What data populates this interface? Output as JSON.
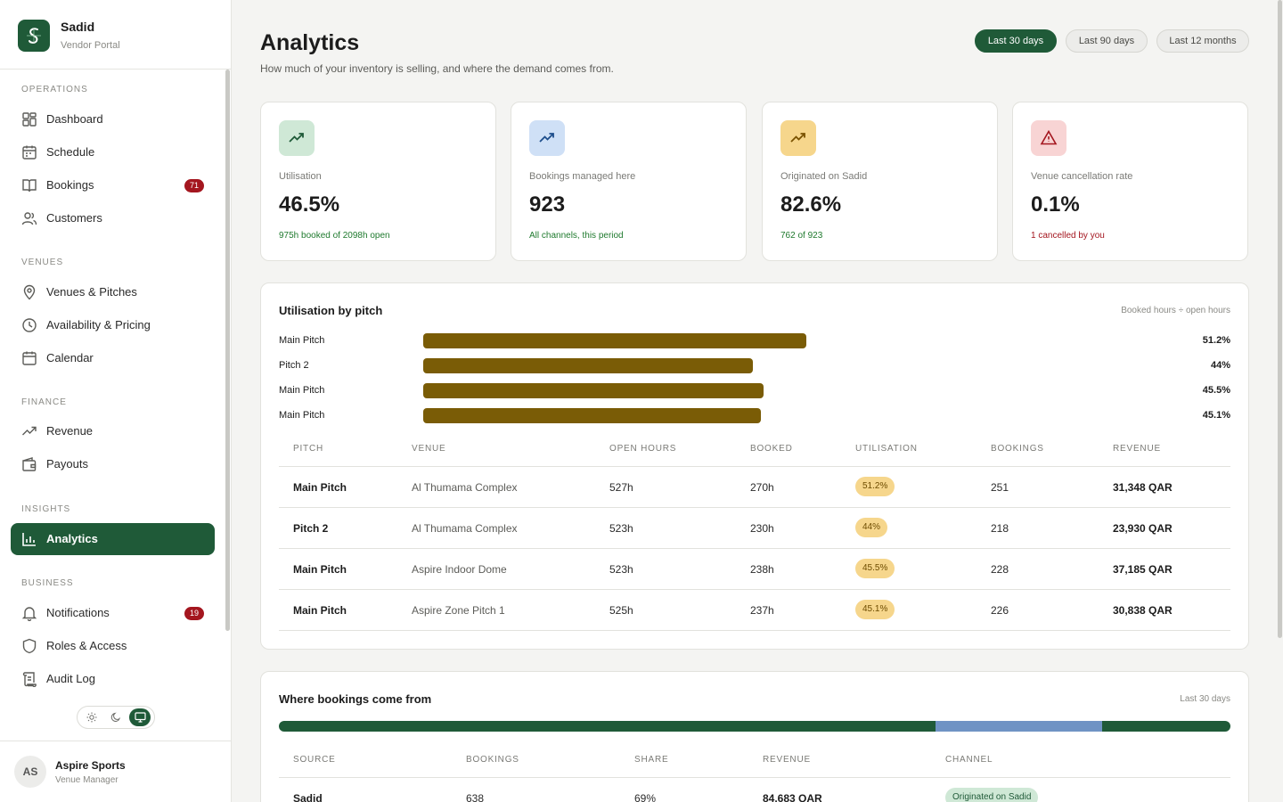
{
  "brand": {
    "name": "Sadid",
    "subtitle": "Vendor Portal"
  },
  "sidebar": {
    "sections": {
      "operations": "OPERATIONS",
      "venues": "VENUES",
      "finance": "FINANCE",
      "insights": "INSIGHTS",
      "business": "BUSINESS"
    },
    "items": {
      "dashboard": "Dashboard",
      "schedule": "Schedule",
      "bookings": "Bookings",
      "bookings_badge": "71",
      "customers": "Customers",
      "venues_pitches": "Venues & Pitches",
      "availability": "Availability & Pricing",
      "calendar": "Calendar",
      "revenue": "Revenue",
      "payouts": "Payouts",
      "analytics": "Analytics",
      "notifications": "Notifications",
      "notifications_badge": "19",
      "roles": "Roles & Access",
      "audit": "Audit Log"
    },
    "theme_selected": "system"
  },
  "user": {
    "initials": "AS",
    "name": "Aspire Sports",
    "role": "Venue Manager"
  },
  "header": {
    "title": "Analytics",
    "subtitle": "How much of your inventory is selling, and where the demand comes from.",
    "ranges": [
      "Last 30 days",
      "Last 90 days",
      "Last 12 months"
    ],
    "selected_range": "Last 30 days"
  },
  "kpis": [
    {
      "label": "Utilisation",
      "value": "46.5%",
      "note": "975h booked of 2098h open",
      "icon": "trend-up-icon",
      "tint": "#cfe8d6",
      "icon_color": "#1f5a38",
      "note_color": "#1f7a2e"
    },
    {
      "label": "Bookings managed here",
      "value": "923",
      "note": "All channels, this period",
      "icon": "trend-up-icon",
      "tint": "#cfe0f6",
      "icon_color": "#1e4e8c",
      "note_color": "#1f7a2e"
    },
    {
      "label": "Originated on Sadid",
      "value": "82.6%",
      "note": "762 of 923",
      "icon": "trend-up-icon",
      "tint": "#f6d68c",
      "icon_color": "#7a5200",
      "note_color": "#1f7a2e"
    },
    {
      "label": "Venue cancellation rate",
      "value": "0.1%",
      "note": "1 cancelled by you",
      "icon": "warning-icon",
      "tint": "#f8d4d4",
      "icon_color": "#a4161f",
      "note_color": "#a4161f"
    }
  ],
  "utilisation": {
    "title": "Utilisation by pitch",
    "hint": "Booked hours ÷ open hours",
    "bars": [
      {
        "name": "Main Pitch",
        "value": 51.2,
        "label": "51.2%"
      },
      {
        "name": "Pitch 2",
        "value": 44,
        "label": "44%"
      },
      {
        "name": "Main Pitch",
        "value": 45.5,
        "label": "45.5%"
      },
      {
        "name": "Main Pitch",
        "value": 45.1,
        "label": "45.1%"
      }
    ],
    "columns": [
      "PITCH",
      "VENUE",
      "OPEN HOURS",
      "BOOKED",
      "UTILISATION",
      "BOOKINGS",
      "REVENUE"
    ],
    "rows": [
      {
        "pitch": "Main Pitch",
        "venue": "Al Thumama Complex",
        "open": "527h",
        "booked": "270h",
        "util": "51.2%",
        "bookings": "251",
        "revenue": "31,348 QAR"
      },
      {
        "pitch": "Pitch 2",
        "venue": "Al Thumama Complex",
        "open": "523h",
        "booked": "230h",
        "util": "44%",
        "bookings": "218",
        "revenue": "23,930 QAR"
      },
      {
        "pitch": "Main Pitch",
        "venue": "Aspire Indoor Dome",
        "open": "523h",
        "booked": "238h",
        "util": "45.5%",
        "bookings": "228",
        "revenue": "37,185 QAR"
      },
      {
        "pitch": "Main Pitch",
        "venue": "Aspire Zone Pitch 1",
        "open": "525h",
        "booked": "237h",
        "util": "45.1%",
        "bookings": "226",
        "revenue": "30,838 QAR"
      }
    ]
  },
  "sources": {
    "title": "Where bookings come from",
    "hint": "Last 30 days",
    "segments": [
      {
        "share": 69,
        "color": "#1f5a38"
      },
      {
        "share": 17.5,
        "color": "#6f93c4"
      },
      {
        "share": 13.5,
        "color": "#1f5a38"
      }
    ],
    "columns": [
      "SOURCE",
      "BOOKINGS",
      "SHARE",
      "REVENUE",
      "CHANNEL"
    ],
    "rows": [
      {
        "source": "Sadid",
        "bookings": "638",
        "share": "69%",
        "revenue": "84,683 QAR",
        "channel": "Originated on Sadid"
      }
    ]
  }
}
